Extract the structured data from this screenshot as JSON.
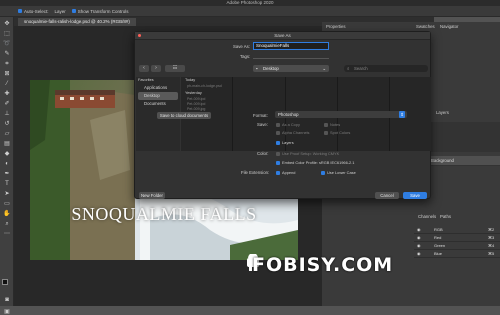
{
  "app_title": "Adobe Photoshop 2020",
  "options_bar": {
    "auto_select": "Auto-Select:",
    "layer": "Layer",
    "show_transform": "Show Transform Controls"
  },
  "document_tab": "snoqualmie-falls-ralish-lodge.psd @ 40.2% (RGB/8#)",
  "photo_title": "SNOQUALMIE FALLS",
  "panels": {
    "properties": "Properties",
    "swatches": "Swatches",
    "navigator": "Navigator",
    "layers": "Layers",
    "channels": "Channels",
    "paths": "Paths",
    "background_layer": "Background",
    "channel_rows": [
      {
        "name": "RGB",
        "key": "⌘2"
      },
      {
        "name": "Red",
        "key": "⌘3"
      },
      {
        "name": "Green",
        "key": "⌘4"
      },
      {
        "name": "Blue",
        "key": "⌘5"
      }
    ]
  },
  "dialog": {
    "title": "Save As",
    "save_as_label": "Save As:",
    "save_as_value": "SnoqualmieFalls",
    "tags_label": "Tags:",
    "location": "Desktop",
    "search_placeholder": "Search",
    "favorites_header": "Favorites",
    "favorites": [
      "Applications",
      "Desktop",
      "Documents"
    ],
    "today_header": "Today",
    "today_item": "ph-main-ch-lodge.psd",
    "yesterday_header": "Yesterday",
    "yesterday_items": [
      "Pet-009.lpd",
      "Pet-009.lpd",
      "Pet-009.jpg"
    ],
    "cloud_button": "Save to cloud documents",
    "format_label": "Format:",
    "format_value": "Photoshop",
    "save_label": "Save:",
    "as_a_copy": "As a Copy",
    "notes": "Notes",
    "alpha_channels": "Alpha Channels",
    "spot_colors": "Spot Colors",
    "layers_option": "Layers",
    "color_label": "Color:",
    "use_proof_setup": "Use Proof Setup: Working CMYK",
    "embed_profile": "Embed Color Profile: sRGB IEC61966-2.1",
    "file_extension_label": "File Extension:",
    "append": "Append",
    "use_lower_case": "Use Lower Case",
    "new_folder": "New Folder",
    "cancel": "Cancel",
    "save": "Save"
  },
  "watermark": "FOBISY.COM",
  "colors": {
    "accent": "#2f7de1",
    "ui_dark": "#323232",
    "canvas": "#282828"
  }
}
